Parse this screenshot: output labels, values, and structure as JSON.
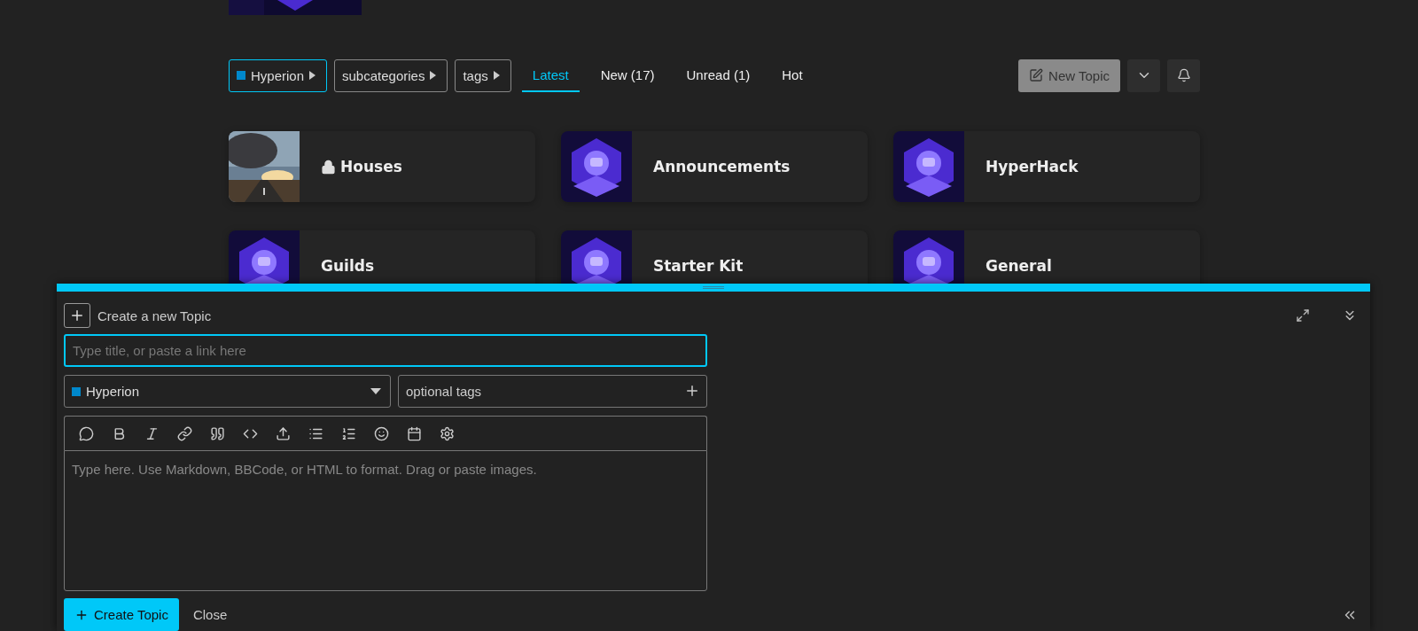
{
  "navigation": {
    "crumbs": [
      {
        "label": "Hyperion",
        "color": "#0088cc",
        "selected": true
      },
      {
        "label": "subcategories",
        "selected": false
      },
      {
        "label": "tags",
        "selected": false
      }
    ],
    "tabs": [
      {
        "label": "Latest",
        "selected": true
      },
      {
        "label": "New (17)",
        "selected": false
      },
      {
        "label": "Unread (1)",
        "selected": false
      },
      {
        "label": "Hot",
        "selected": false
      }
    ],
    "new_topic_button": "New Topic"
  },
  "categories": [
    {
      "name": "Houses",
      "locked": true
    },
    {
      "name": "Announcements",
      "locked": false
    },
    {
      "name": "HyperHack",
      "locked": false
    },
    {
      "name": "Guilds",
      "locked": false
    },
    {
      "name": "Starter Kit",
      "locked": false
    },
    {
      "name": "General",
      "locked": false
    }
  ],
  "composer": {
    "title": "Create a new Topic",
    "title_field": {
      "placeholder": "Type title, or paste a link here"
    },
    "category": {
      "value": "Hyperion",
      "color": "#0088cc"
    },
    "tags_field": {
      "placeholder": "optional tags"
    },
    "editor": {
      "placeholder": "Type here. Use Markdown, BBCode, or HTML to format. Drag or paste images."
    },
    "submit": "Create Topic",
    "close": "Close"
  }
}
